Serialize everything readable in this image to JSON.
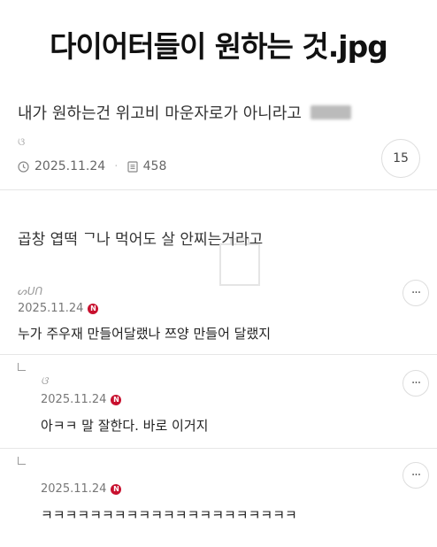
{
  "meme_title": "다이어터들이 원하는 것.jpg",
  "post": {
    "title": "내가 원하는건 위고비 마운자로가 아니라고",
    "author_mark": "ଓ",
    "date": "2025.11.24",
    "views": "458",
    "comment_count": "15",
    "body": "곱창 엽떡 ᄀ나 먹어도 살 안찌는거라고"
  },
  "comments": [
    {
      "author": "ᔕᑌᑎ",
      "date": "2025.11.24",
      "text": "누가 주우재 만들어달랬나 쯔양 만들어 달랬지",
      "more": "···"
    },
    {
      "author": "ଓ",
      "date": "2025.11.24",
      "text": "아ㅋㅋ 말 잘한다. 바로 이거지",
      "more": "···"
    },
    {
      "author": "",
      "date": "2025.11.24",
      "text": "ㅋㅋㅋㅋㅋㅋㅋㅋㅋㅋㅋㅋㅋㅋㅋㅋㅋㅋㅋㅋㅋ",
      "more": "···"
    }
  ],
  "badge_letter": "N",
  "colors": {
    "badge": "#c8102e"
  }
}
